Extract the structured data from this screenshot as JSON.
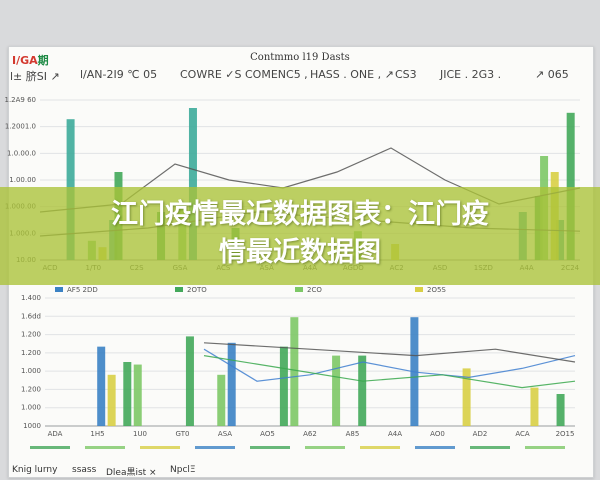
{
  "header": {
    "logo_text": "I/GA",
    "logo_accent": "期",
    "title": "Contmmo l19 Dasts",
    "subtitle_segments": [
      "l± 脐SI ↗",
      "l/AN-2I9 ℃ 05",
      "COWRE ✓S COMENC5 ,",
      "HASS . ONE , ↗",
      "CS3",
      "JICE . 2G3 .",
      "↗ 065"
    ]
  },
  "headline": {
    "lines": [
      "江门疫情最近数据图表：江门疫",
      "情最近数据图"
    ],
    "band_color": "#aac337"
  },
  "footer": {
    "segments": [
      "Knig lurny",
      "ssass",
      "Dlea黒ist ×",
      "NpclΞ"
    ]
  },
  "colors": {
    "teal": "#3dab9a",
    "green": "#43a85a",
    "lightgreen": "#7dc866",
    "blue": "#3b82c4",
    "yellow": "#d8cf45",
    "line_dark": "#555555",
    "line_blue": "#3f7fd0",
    "line_green": "#3aa84e"
  },
  "chart_data": [
    {
      "type": "bar",
      "title": "Contmmo l19 Dasts",
      "ylim": [
        0,
        1
      ],
      "y_ticks": [
        "1.2A9 60",
        "1.2001.0",
        "1.0.00.0",
        "1.00.00",
        "1.000.00",
        "1.000.0",
        "10.00"
      ],
      "x_ticks": [
        "ACD",
        "1/T0",
        "C2S",
        "GSA",
        "ACS",
        "ASA",
        "A4A",
        "AGDO",
        "AC2",
        "ASD",
        "1SZD",
        "A4A",
        "2C24"
      ],
      "series": [
        {
          "color": "teal",
          "points": [
            [
              0.05,
              0.88
            ],
            [
              0.13,
              0.25
            ],
            [
              0.28,
              0.95
            ],
            [
              0.9,
              0.3
            ],
            [
              0.97,
              0.25
            ]
          ]
        },
        {
          "color": "green",
          "points": [
            [
              0.14,
              0.55
            ],
            [
              0.22,
              0.3
            ],
            [
              0.36,
              0.2
            ],
            [
              0.93,
              0.4
            ],
            [
              0.99,
              0.92
            ]
          ]
        },
        {
          "color": "lightgreen",
          "points": [
            [
              0.09,
              0.12
            ],
            [
              0.26,
              0.35
            ],
            [
              0.59,
              0.18
            ],
            [
              0.94,
              0.65
            ]
          ]
        },
        {
          "color": "yellow",
          "points": [
            [
              0.11,
              0.08
            ],
            [
              0.66,
              0.1
            ],
            [
              0.96,
              0.55
            ]
          ]
        }
      ],
      "lines": [
        {
          "color": "line_dark",
          "points": [
            [
              0.0,
              0.3
            ],
            [
              0.15,
              0.35
            ],
            [
              0.25,
              0.6
            ],
            [
              0.35,
              0.5
            ],
            [
              0.45,
              0.45
            ],
            [
              0.55,
              0.55
            ],
            [
              0.65,
              0.7
            ],
            [
              0.75,
              0.5
            ],
            [
              0.85,
              0.35
            ],
            [
              1.0,
              0.45
            ]
          ]
        },
        {
          "color": "line_dark",
          "points": [
            [
              0.0,
              0.15
            ],
            [
              0.2,
              0.2
            ],
            [
              0.4,
              0.3
            ],
            [
              0.6,
              0.25
            ],
            [
              0.8,
              0.2
            ],
            [
              1.0,
              0.18
            ]
          ]
        }
      ]
    },
    {
      "type": "bar",
      "ylim": [
        0,
        1
      ],
      "y_ticks": [
        "1.400",
        "1.6dd",
        "1.200",
        "1.200",
        "1.000",
        "1.200",
        "1.000",
        "1000"
      ],
      "x_ticks": [
        "ADA",
        "1H5",
        "1U0",
        "GT0",
        "ASA",
        "AO5",
        "A62",
        "A85",
        "A4A",
        "AO0",
        "AD2",
        "ACA",
        "2O15"
      ],
      "legend": [
        "AF5 2DD",
        "2OTO",
        "2CO",
        "2O5S"
      ],
      "series": [
        {
          "color": "blue",
          "points": [
            [
              0.1,
              0.62
            ],
            [
              0.35,
              0.65
            ],
            [
              0.7,
              0.85
            ]
          ]
        },
        {
          "color": "green",
          "points": [
            [
              0.15,
              0.5
            ],
            [
              0.27,
              0.7
            ],
            [
              0.45,
              0.62
            ],
            [
              0.6,
              0.55
            ],
            [
              0.98,
              0.25
            ]
          ]
        },
        {
          "color": "lightgreen",
          "points": [
            [
              0.17,
              0.48
            ],
            [
              0.33,
              0.4
            ],
            [
              0.47,
              0.85
            ],
            [
              0.55,
              0.55
            ]
          ]
        },
        {
          "color": "yellow",
          "points": [
            [
              0.12,
              0.4
            ],
            [
              0.8,
              0.45
            ],
            [
              0.93,
              0.3
            ]
          ]
        }
      ],
      "lines": [
        {
          "color": "line_blue",
          "points": [
            [
              0.3,
              0.6
            ],
            [
              0.4,
              0.35
            ],
            [
              0.5,
              0.4
            ],
            [
              0.6,
              0.5
            ],
            [
              0.7,
              0.42
            ],
            [
              0.8,
              0.38
            ],
            [
              0.9,
              0.45
            ],
            [
              1.0,
              0.55
            ]
          ]
        },
        {
          "color": "line_green",
          "points": [
            [
              0.3,
              0.55
            ],
            [
              0.45,
              0.45
            ],
            [
              0.6,
              0.35
            ],
            [
              0.75,
              0.4
            ],
            [
              0.9,
              0.3
            ],
            [
              1.0,
              0.35
            ]
          ]
        },
        {
          "color": "line_dark",
          "points": [
            [
              0.3,
              0.65
            ],
            [
              0.5,
              0.6
            ],
            [
              0.7,
              0.55
            ],
            [
              0.85,
              0.6
            ],
            [
              1.0,
              0.5
            ]
          ]
        }
      ]
    }
  ]
}
